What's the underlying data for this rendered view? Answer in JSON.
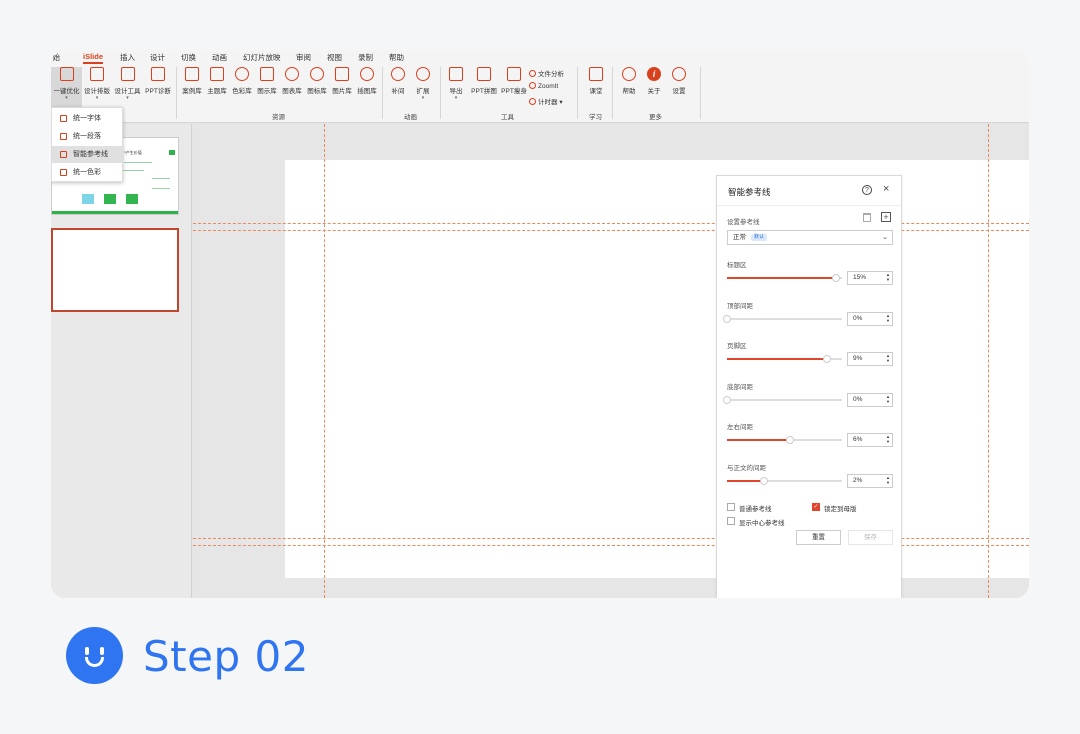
{
  "menu_tabs": [
    "开始",
    "iSlide",
    "插入",
    "设计",
    "切换",
    "动画",
    "幻灯片放映",
    "审阅",
    "视图",
    "录制",
    "帮助"
  ],
  "ribbon": {
    "tools": {
      "one_click": "一键优化",
      "design_layout": "设计排版",
      "design_tools": "设计工具",
      "ppt_diagnose": "PPT诊断",
      "case_lib": "案例库",
      "theme_lib": "主题库",
      "color_lib": "色彩库",
      "diagram_lib": "图示库",
      "chart_lib": "图表库",
      "icon_lib": "图标库",
      "image_lib": "图片库",
      "illustration_lib": "插图库",
      "tween": "补间",
      "extend": "扩展",
      "export": "导出",
      "ppt_puzzle": "PPT拼图",
      "ppt_slim": "PPT瘦身",
      "doc_analysis": "文件分析",
      "zoomit": "ZoomIt",
      "timer": "计时器",
      "classroom": "课堂",
      "help": "帮助",
      "about": "关于",
      "settings": "设置"
    },
    "groups": {
      "resources": "资源",
      "animation": "动画",
      "tools": "工具",
      "learn": "学习",
      "more": "更多"
    }
  },
  "dropdown": {
    "items": [
      "统一字体",
      "统一段落",
      "智能参考线",
      "统一色彩"
    ],
    "active_index": 2
  },
  "thumbnail": {
    "title": "IP产生价值"
  },
  "panel": {
    "title": "智能参考线",
    "setup_label": "设置参考线",
    "preset": "正常",
    "preset_badge": "默认",
    "sliders": [
      {
        "label": "标题区",
        "value": "15%",
        "fraction": 0.95
      },
      {
        "label": "顶部间距",
        "value": "0%",
        "fraction": 0.0
      },
      {
        "label": "页脚区",
        "value": "9%",
        "fraction": 0.87
      },
      {
        "label": "底部间距",
        "value": "0%",
        "fraction": 0.0
      },
      {
        "label": "左右间距",
        "value": "6%",
        "fraction": 0.55
      },
      {
        "label": "与正文的间距",
        "value": "2%",
        "fraction": 0.32
      }
    ],
    "checkboxes": [
      {
        "label": "普通参考线",
        "checked": false
      },
      {
        "label": "锁定到母版",
        "checked": true
      },
      {
        "label": "显示中心参考线",
        "checked": false
      }
    ],
    "reset_label": "重置",
    "save_label": "保存"
  },
  "step": {
    "label": "Step 02"
  },
  "colors": {
    "accent": "#d9411e",
    "slider_fill": "#e0462b",
    "guide": "#e98a5d",
    "step_blue": "#2f74f0"
  },
  "icons": {
    "help": "question-circle-icon",
    "close": "close-icon",
    "trash": "trash-icon",
    "add": "plus-square-icon",
    "smiley": "smiley-icon"
  }
}
